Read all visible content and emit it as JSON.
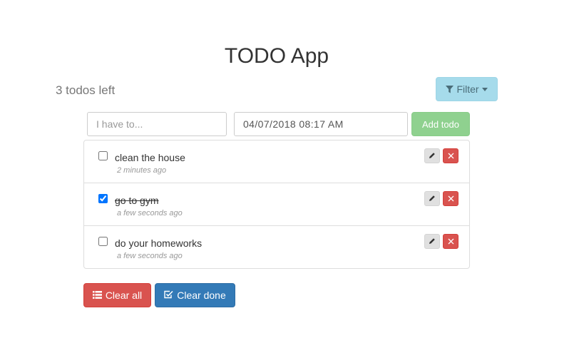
{
  "header": {
    "title": "TODO App"
  },
  "summary": {
    "count_text": "3 todos left"
  },
  "filter": {
    "label": "Filter",
    "icon": "filter-icon",
    "caret": "chevron-down-icon"
  },
  "form": {
    "todo_placeholder": "I have to...",
    "todo_value": "",
    "date_value": "04/07/2018 08:17 AM",
    "add_label": "Add todo"
  },
  "todos": [
    {
      "text": "clean the house",
      "time": "2 minutes ago",
      "done": false
    },
    {
      "text": "go to gym",
      "time": "a few seconds ago",
      "done": true
    },
    {
      "text": "do your homeworks",
      "time": "a few seconds ago",
      "done": false
    }
  ],
  "actions": {
    "clear_all_label": "Clear all",
    "clear_done_label": "Clear done"
  },
  "colors": {
    "danger": "#d9534f",
    "primary": "#337ab7",
    "success": "#8fd18f",
    "info": "#a6dbeb"
  }
}
